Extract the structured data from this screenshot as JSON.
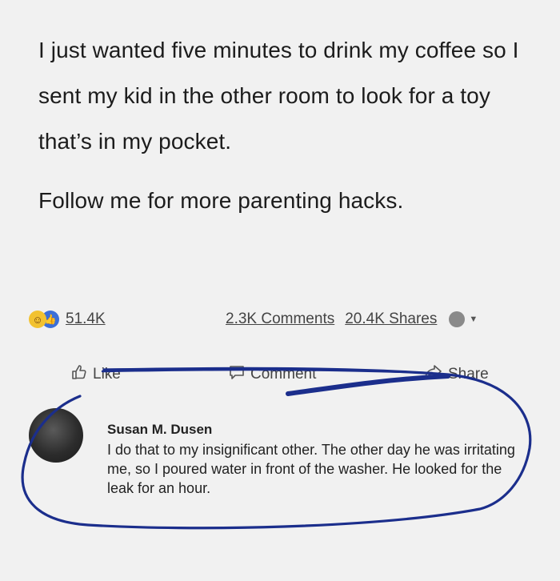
{
  "post": {
    "text_main": "I just wanted five minutes to drink my coffee so I sent my kid in the other room to look for a toy that’s in my pocket.",
    "text_follow": "Follow me for more parenting hacks."
  },
  "stats": {
    "reactions_count": "51.4K",
    "comments": "2.3K Comments",
    "shares": "20.4K Shares"
  },
  "actions": {
    "like": "Like",
    "comment": "Comment",
    "share": "Share"
  },
  "comment": {
    "author": "Susan M. Dusen",
    "text": "I do that to my insignificant other.  The other day he was irritating me, so I poured water in front of the washer.  He looked for the leak for an hour."
  },
  "colors": {
    "background": "#f1f1f1",
    "annotation_ink": "#1b2e8c"
  },
  "icons": [
    "haha-reaction-icon",
    "like-reaction-icon",
    "thumbs-up-icon",
    "speech-bubble-icon",
    "share-arrow-icon",
    "avatar-icon",
    "chevron-down-icon"
  ]
}
